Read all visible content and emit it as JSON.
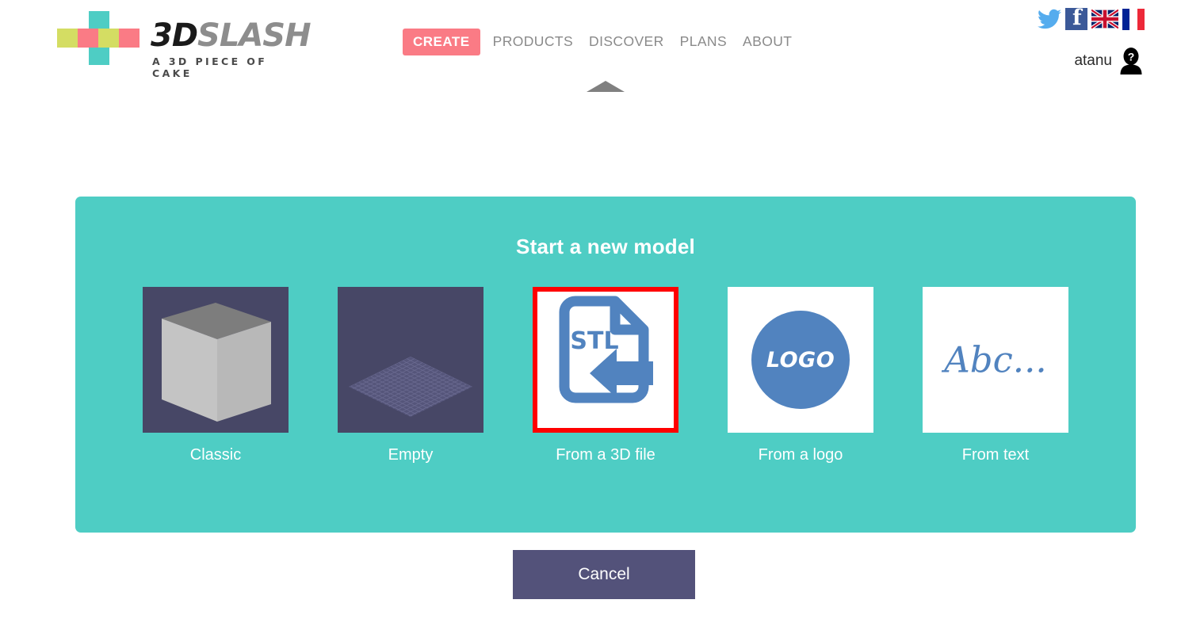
{
  "brand": {
    "name_bold": "3D",
    "name_light": "SLASH",
    "tagline": "A 3D PIECE OF CAKE",
    "logo_colors": {
      "teal": "#4ecdc4",
      "lime": "#d4dd63",
      "pink": "#fa7b85"
    }
  },
  "nav": {
    "create_label": "CREATE",
    "create_color": "#fa7b85",
    "items": [
      {
        "label": "PRODUCTS"
      },
      {
        "label": "DISCOVER"
      },
      {
        "label": "PLANS"
      },
      {
        "label": "ABOUT"
      }
    ]
  },
  "top_right": {
    "twitter_icon": "twitter-bird-icon",
    "facebook_icon": "facebook-icon",
    "flag_uk_icon": "uk-flag-icon",
    "flag_fr_icon": "france-flag-icon",
    "username": "atanu",
    "avatar_icon": "user-avatar-question-icon"
  },
  "panel": {
    "title": "Start a new model",
    "background_color": "#4ecdc4",
    "tiles": [
      {
        "label": "Classic",
        "thumb": "3d-cube-thumbnail",
        "selected": false
      },
      {
        "label": "Empty",
        "thumb": "empty-baseplate-thumbnail",
        "selected": false
      },
      {
        "label": "From a 3D file",
        "thumb": "stl-file-import-icon",
        "selected": true,
        "highlight_color": "#ff0000",
        "badge_text": "STL"
      },
      {
        "label": "From a logo",
        "thumb": "logo-circle-thumbnail",
        "badge_text": "LOGO",
        "selected": false
      },
      {
        "label": "From text",
        "thumb": "script-text-thumbnail",
        "badge_text": "Abc...",
        "selected": false
      }
    ]
  },
  "footer": {
    "cancel_label": "Cancel",
    "cancel_color": "#53527a"
  }
}
